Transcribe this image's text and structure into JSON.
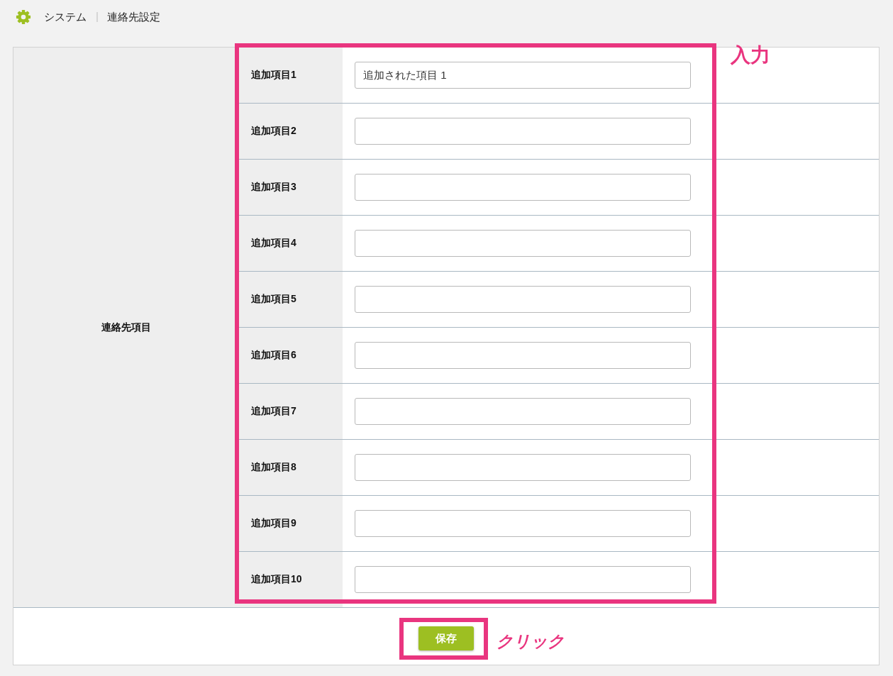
{
  "breadcrumb": [
    "システム",
    "連絡先設定"
  ],
  "form": {
    "group_label": "連絡先項目",
    "fields": [
      {
        "label": "追加項目1",
        "value": "追加された項目 1"
      },
      {
        "label": "追加項目2"
      },
      {
        "label": "追加項目3"
      },
      {
        "label": "追加項目4"
      },
      {
        "label": "追加項目5"
      },
      {
        "label": "追加項目6"
      },
      {
        "label": "追加項目7"
      },
      {
        "label": "追加項目8"
      },
      {
        "label": "追加項目9"
      },
      {
        "label": "追加項目10"
      }
    ]
  },
  "save_button": {
    "label": "保存"
  },
  "annotations": [
    {
      "kind": "fields",
      "label": "入力"
    },
    {
      "kind": "save",
      "label": "クリック"
    }
  ]
}
